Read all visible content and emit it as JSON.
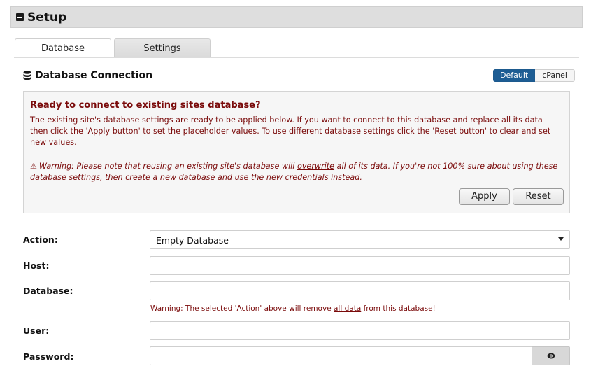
{
  "header": {
    "title": "Setup"
  },
  "tabs": [
    {
      "label": "Database",
      "active": true
    },
    {
      "label": "Settings",
      "active": false
    }
  ],
  "section": {
    "title": "Database Connection",
    "icon": "database-icon"
  },
  "mode_toggle": {
    "options": [
      "Default",
      "cPanel"
    ],
    "selected": "Default"
  },
  "notice": {
    "heading": "Ready to connect to existing sites database?",
    "body": "The existing site's database settings are ready to be applied below. If you want to connect to this database and replace all its data then click the 'Apply button' to set the placeholder values. To use different database settings click the 'Reset button' to clear and set new values.",
    "warning_before": "Warning: Please note that reusing an existing site's database will ",
    "warning_link": "overwrite",
    "warning_after": " all of its data. If you're not 100% sure about using these database settings, then create a new database and use the new credentials instead.",
    "apply_label": "Apply",
    "reset_label": "Reset"
  },
  "form": {
    "action_label": "Action:",
    "action_value": "Empty Database",
    "host_label": "Host:",
    "host_value": "",
    "database_label": "Database:",
    "database_value": "",
    "database_warning_before": "Warning: The selected 'Action' above will remove ",
    "database_warning_emph": "all data",
    "database_warning_after": " from this database!",
    "user_label": "User:",
    "user_value": "",
    "password_label": "Password:",
    "password_value": ""
  },
  "colors": {
    "accent": "#1d5d94",
    "warning_text": "#7a0a0a"
  }
}
